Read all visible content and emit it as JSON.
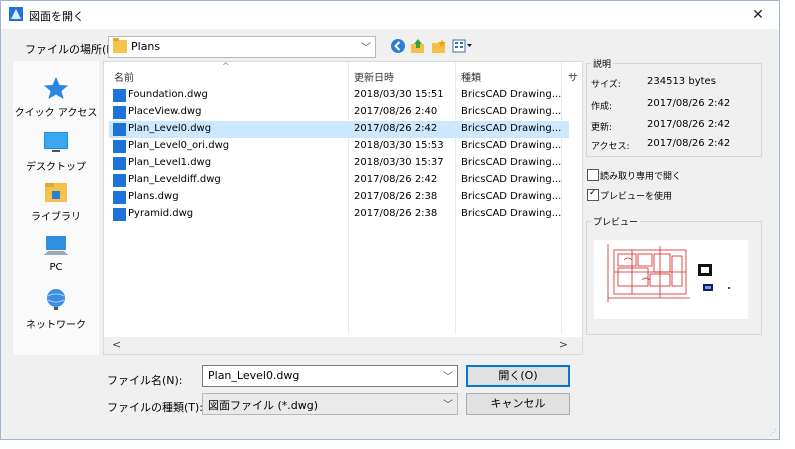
{
  "window": {
    "title": "図面を開く",
    "close_glyph": "✕"
  },
  "lookin": {
    "label": "ファイルの場所(I):",
    "value": "Plans"
  },
  "toolbar": {
    "icons": [
      "back-icon",
      "up-folder-icon",
      "new-folder-icon",
      "view-menu-icon"
    ]
  },
  "places": [
    {
      "label": "クイック アクセス",
      "icon": "quick-access-star-icon"
    },
    {
      "label": "デスクトップ",
      "icon": "desktop-icon"
    },
    {
      "label": "ライブラリ",
      "icon": "library-icon"
    },
    {
      "label": "PC",
      "icon": "pc-icon"
    },
    {
      "label": "ネットワーク",
      "icon": "network-icon"
    }
  ],
  "filelist": {
    "columns": [
      "名前",
      "更新日時",
      "種類",
      "サ"
    ],
    "sort_glyph": "^",
    "rows": [
      {
        "name": "Foundation.dwg",
        "date": "2018/03/30 15:51",
        "type": "BricsCAD Drawing...",
        "selected": false
      },
      {
        "name": "PlaceView.dwg",
        "date": "2017/08/26 2:40",
        "type": "BricsCAD Drawing...",
        "selected": false
      },
      {
        "name": "Plan_Level0.dwg",
        "date": "2017/08/26 2:42",
        "type": "BricsCAD Drawing...",
        "selected": true
      },
      {
        "name": "Plan_Level0_ori.dwg",
        "date": "2018/03/30 15:53",
        "type": "BricsCAD Drawing...",
        "selected": false
      },
      {
        "name": "Plan_Level1.dwg",
        "date": "2018/03/30 15:37",
        "type": "BricsCAD Drawing...",
        "selected": false
      },
      {
        "name": "Plan_Leveldiff.dwg",
        "date": "2017/08/26 2:42",
        "type": "BricsCAD Drawing...",
        "selected": false
      },
      {
        "name": "Plans.dwg",
        "date": "2017/08/26 2:38",
        "type": "BricsCAD Drawing...",
        "selected": false
      },
      {
        "name": "Pyramid.dwg",
        "date": "2017/08/26 2:38",
        "type": "BricsCAD Drawing...",
        "selected": false
      }
    ],
    "scroll_left": "<",
    "scroll_right": ">"
  },
  "filename": {
    "label": "ファイル名(N):",
    "value": "Plan_Level0.dwg"
  },
  "filetype": {
    "label": "ファイルの種類(T):",
    "value": "図面ファイル (*.dwg)"
  },
  "buttons": {
    "open": "開く(O)",
    "cancel": "キャンセル"
  },
  "info": {
    "title": "説明",
    "size_k": "サイズ:",
    "size_v": "234513 bytes",
    "created_k": "作成:",
    "created_v": "2017/08/26 2:42",
    "modified_k": "更新:",
    "modified_v": "2017/08/26 2:42",
    "access_k": "アクセス:",
    "access_v": "2017/08/26 2:42"
  },
  "options": {
    "readonly_label": "読み取り専用で開く",
    "readonly_checked": false,
    "preview_label": "プレビューを使用",
    "preview_checked": true
  },
  "preview": {
    "title": "プレビュー"
  },
  "colors": {
    "accent": "#0078d7",
    "selection": "#cce8ff",
    "cad_red": "#d62020"
  }
}
